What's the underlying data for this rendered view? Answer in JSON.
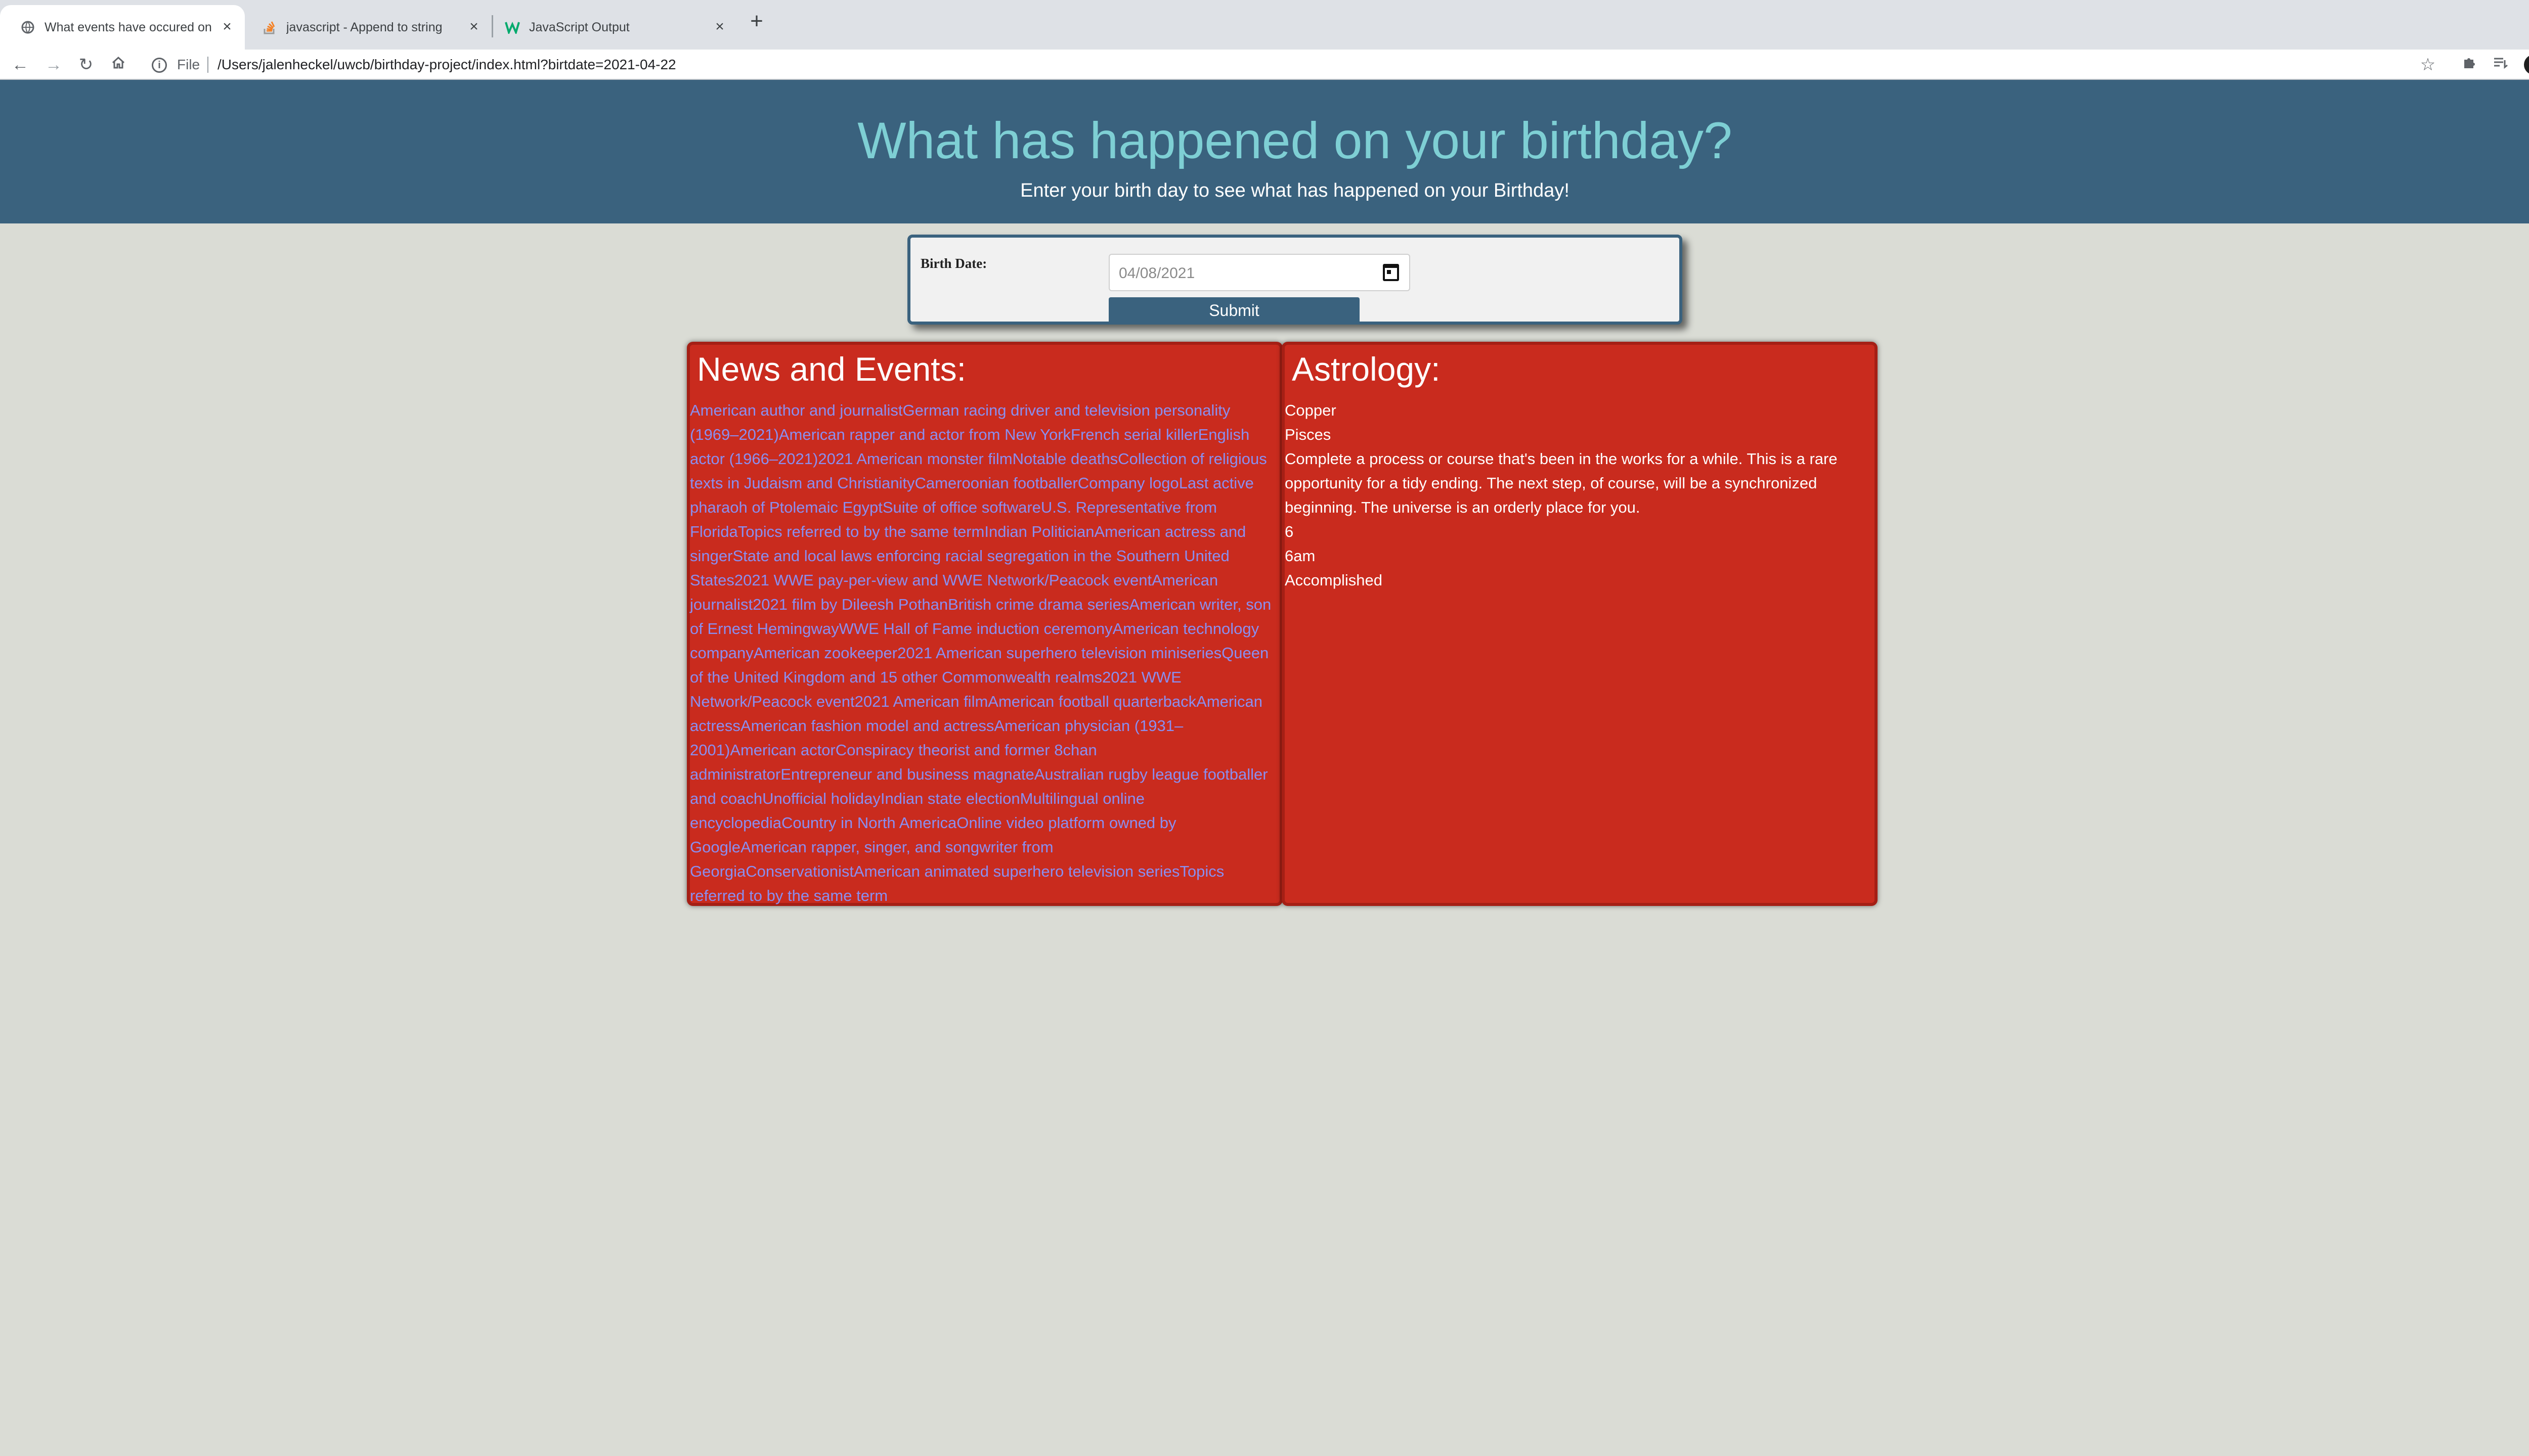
{
  "browser": {
    "tabs": [
      {
        "title": "What events have occured on",
        "favicon": "globe-icon",
        "active": true
      },
      {
        "title": "javascript - Append to string",
        "favicon": "stackoverflow-icon",
        "active": false
      },
      {
        "title": "JavaScript Output",
        "favicon": "w3schools-icon",
        "active": false
      }
    ],
    "file_label": "File",
    "url": "/Users/jalenheckel/uwcb/birthday-project/index.html?birtdate=2021-04-22"
  },
  "header": {
    "title": "What has happened on your birthday?",
    "subtitle": "Enter your birth day to see what has happened on your Birthday!"
  },
  "form": {
    "label": "Birth Date:",
    "date_value": "04/08/2021",
    "submit_label": "Submit"
  },
  "news": {
    "heading": "News and Events:",
    "items": [
      "American author and journalist",
      "German racing driver and television personality (1969–2021)",
      "American rapper and actor from New York",
      "French serial killer",
      "English actor (1966–2021)",
      "2021 American monster film",
      "Notable deaths",
      "Collection of religious texts in Judaism and Christianity",
      "Cameroonian footballer",
      "Company logo",
      "Last active pharaoh of Ptolemaic Egypt",
      "Suite of office software",
      "U.S. Representative from Florida",
      "Topics referred to by the same term",
      "Indian Politician",
      "American actress and singer",
      "State and local laws enforcing racial segregation in the Southern United States",
      "2021 WWE pay-per-view and WWE Network/Peacock event",
      "American journalist",
      "2021 film by Dileesh Pothan",
      "British crime drama series",
      "American writer, son of Ernest Hemingway",
      "WWE Hall of Fame induction ceremony",
      "American technology company",
      "American zookeeper",
      "2021 American superhero television miniseries",
      "Queen of the United Kingdom and 15 other Commonwealth realms",
      "2021 WWE Network/Peacock event",
      "2021 American film",
      "American football quarterback",
      "American actress",
      "American fashion model and actress",
      "American physician (1931–2001)",
      "American actor",
      "Conspiracy theorist and former 8chan administrator",
      "Entrepreneur and business magnate",
      "Australian rugby league footballer and coach",
      "Unofficial holiday",
      "Indian state election",
      "Multilingual online encyclopedia",
      "Country in North America",
      "Online video platform owned by Google",
      "American rapper, singer, and songwriter from Georgia",
      "Conservationist",
      "American animated superhero television series",
      "Topics referred to by the same term"
    ]
  },
  "astrology": {
    "heading": "Astrology:",
    "items": [
      "Copper",
      "Pisces",
      "Complete a process or course that's been in the works for a while. This is a rare opportunity for a tidy ending. The next step, of course, will be a synchronized beginning. The universe is an orderly place for you.",
      "6",
      "6am",
      "Accomplished"
    ]
  },
  "colors": {
    "header_bg": "#3a627e",
    "title": "#7ecfd4",
    "panel_bg": "#c92b1e",
    "link": "#8a8ff0",
    "page_bg": "#dadcd5"
  }
}
